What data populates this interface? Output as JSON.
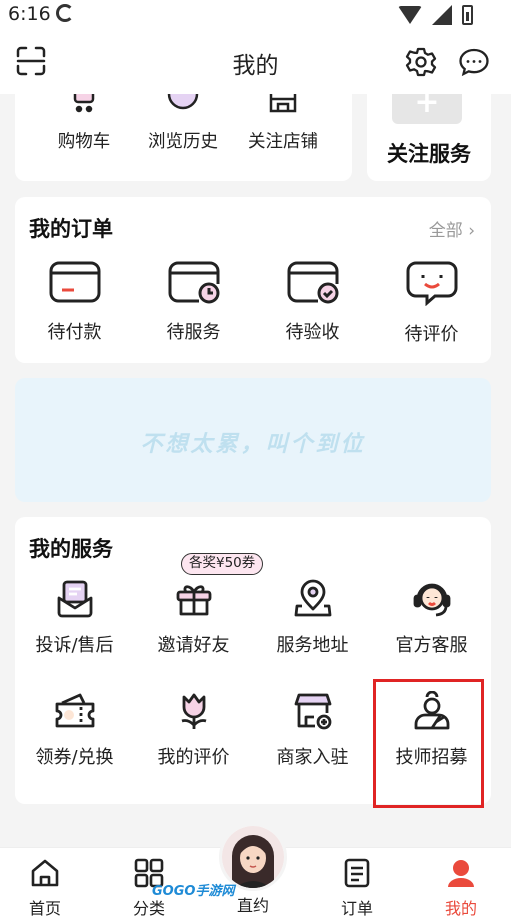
{
  "status": {
    "time": "6:16"
  },
  "header": {
    "title": "我的"
  },
  "shortcuts": [
    {
      "label": "购物车",
      "icon": "cart-icon"
    },
    {
      "label": "浏览历史",
      "icon": "history-icon"
    },
    {
      "label": "关注店铺",
      "icon": "store-icon"
    }
  ],
  "follow_service": {
    "label": "关注服务",
    "icon": "plus-icon"
  },
  "orders": {
    "title": "我的订单",
    "all_label": "全部",
    "items": [
      {
        "label": "待付款",
        "icon": "wallet-icon"
      },
      {
        "label": "待服务",
        "icon": "card-clock-icon"
      },
      {
        "label": "待验收",
        "icon": "card-check-icon"
      },
      {
        "label": "待评价",
        "icon": "smile-chat-icon"
      }
    ]
  },
  "banner": {
    "text": "不想太累，叫个到位"
  },
  "services": {
    "title": "我的服务",
    "reward_badge": "各奖¥50券",
    "items": [
      {
        "label": "投诉/售后",
        "icon": "mail-icon"
      },
      {
        "label": "邀请好友",
        "icon": "gift-icon"
      },
      {
        "label": "服务地址",
        "icon": "location-icon"
      },
      {
        "label": "官方客服",
        "icon": "headset-icon"
      },
      {
        "label": "领券/兑换",
        "icon": "coupon-icon"
      },
      {
        "label": "我的评价",
        "icon": "tulip-icon"
      },
      {
        "label": "商家入驻",
        "icon": "shop-plus-icon"
      },
      {
        "label": "技师招募",
        "icon": "technician-icon"
      }
    ]
  },
  "tabbar": {
    "tabs": [
      {
        "label": "首页",
        "icon": "home-icon"
      },
      {
        "label": "分类",
        "icon": "grid-icon"
      },
      {
        "label": "直约",
        "icon": "avatar-icon"
      },
      {
        "label": "订单",
        "icon": "list-icon"
      },
      {
        "label": "我的",
        "icon": "profile-icon"
      }
    ],
    "active_color": "#ea4a3c"
  },
  "watermark": {
    "text": "GOGO手游网"
  }
}
